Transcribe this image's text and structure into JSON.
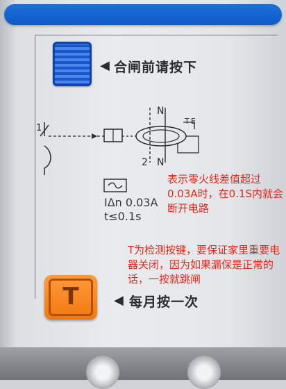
{
  "reset_label": "合闸前请按下",
  "test_label": "每月按一次",
  "test_key": "T",
  "schematic": {
    "pole_number": "1",
    "top_n": "N",
    "bottom_2": "2",
    "bottom_n": "N",
    "test_t": "T",
    "test_e": "E"
  },
  "spec": {
    "current": "IΔn 0.03A",
    "time": "t≤0.1s"
  },
  "annotations": {
    "current_note": "表示零火线差值超过0.03A时，在0.1S内就会断开电路",
    "test_note": "T为检测按键，要保证家里重要电器关闭，因为如果漏保是正常的话，一按就跳闸"
  },
  "colors": {
    "strip_blue": "#0c5bc7",
    "reset_button_blue": "#1f60d4",
    "test_button_orange": "#f2780f",
    "annotation_red": "#e8261b"
  },
  "icons": [
    "arrow-left-icon",
    "ac-symbol-icon"
  ]
}
